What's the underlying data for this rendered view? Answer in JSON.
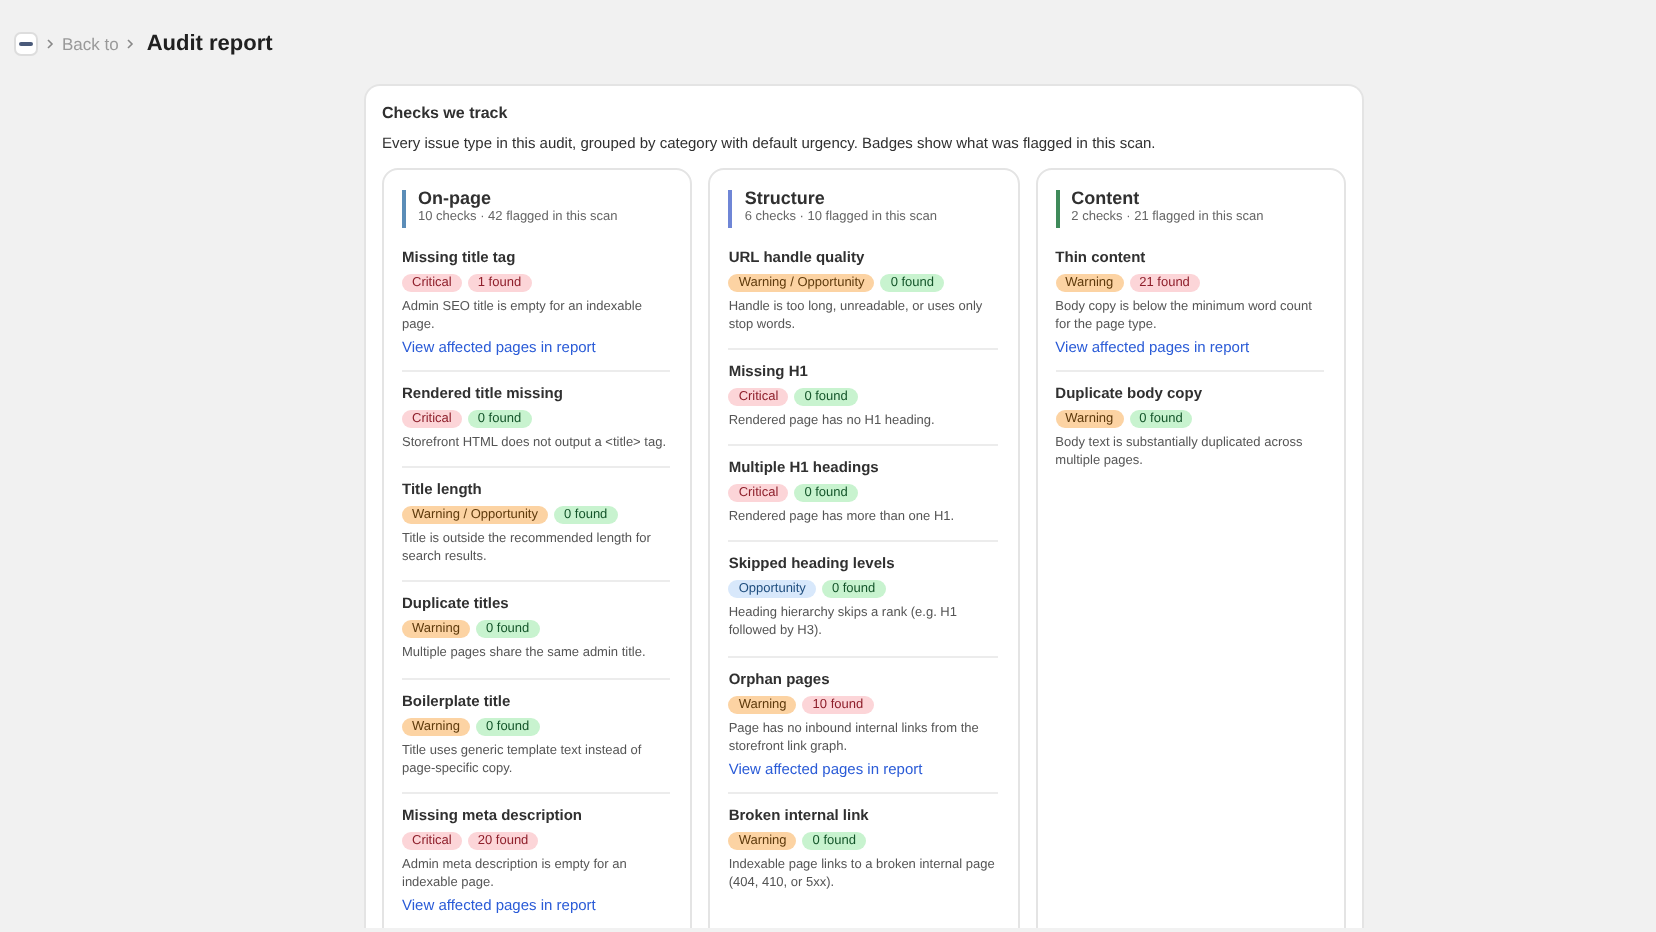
{
  "breadcrumb": {
    "back": "Back to",
    "title": "Audit report"
  },
  "panel": {
    "title": "Checks we track",
    "description": "Every issue type in this audit, grouped by category with default urgency. Badges show what was flagged in this scan."
  },
  "categories": [
    {
      "name": "On-page",
      "summary": "10 checks · 42 flagged in this scan",
      "color": "#5b8db8",
      "checks": [
        {
          "title": "Missing title tag",
          "kind": "critical",
          "severity_label": "Critical",
          "found": "1 found",
          "flagged": true,
          "description": "Admin SEO title is empty for an indexable page.",
          "link": "View affected pages in report"
        },
        {
          "title": "Rendered title missing",
          "kind": "critical",
          "severity_label": "Critical",
          "found": "0 found",
          "flagged": false,
          "description": "Storefront HTML does not output a <title> tag."
        },
        {
          "title": "Title length",
          "kind": "warning",
          "severity_label": "Warning / Opportunity",
          "found": "0 found",
          "flagged": false,
          "description": "Title is outside the recommended length for search results."
        },
        {
          "title": "Duplicate titles",
          "kind": "warning",
          "severity_label": "Warning",
          "found": "0 found",
          "flagged": false,
          "description": "Multiple pages share the same admin title."
        },
        {
          "title": "Boilerplate title",
          "kind": "warning",
          "severity_label": "Warning",
          "found": "0 found",
          "flagged": false,
          "description": "Title uses generic template text instead of page-specific copy."
        },
        {
          "title": "Missing meta description",
          "kind": "critical",
          "severity_label": "Critical",
          "found": "20 found",
          "flagged": true,
          "description": "Admin meta description is empty for an indexable page.",
          "link": "View affected pages in report"
        }
      ]
    },
    {
      "name": "Structure",
      "summary": "6 checks · 10 flagged in this scan",
      "color": "#6f86d6",
      "checks": [
        {
          "title": "URL handle quality",
          "kind": "warning",
          "severity_label": "Warning / Opportunity",
          "found": "0 found",
          "flagged": false,
          "description": "Handle is too long, unreadable, or uses only stop words."
        },
        {
          "title": "Missing H1",
          "kind": "critical",
          "severity_label": "Critical",
          "found": "0 found",
          "flagged": false,
          "description": "Rendered page has no H1 heading."
        },
        {
          "title": "Multiple H1 headings",
          "kind": "critical",
          "severity_label": "Critical",
          "found": "0 found",
          "flagged": false,
          "description": "Rendered page has more than one H1."
        },
        {
          "title": "Skipped heading levels",
          "kind": "opportunity",
          "severity_label": "Opportunity",
          "found": "0 found",
          "flagged": false,
          "description": "Heading hierarchy skips a rank (e.g. H1 followed by H3)."
        },
        {
          "title": "Orphan pages",
          "kind": "warning",
          "severity_label": "Warning",
          "found": "10 found",
          "flagged": true,
          "description": "Page has no inbound internal links from the storefront link graph.",
          "link": "View affected pages in report"
        },
        {
          "title": "Broken internal link",
          "kind": "warning",
          "severity_label": "Warning",
          "found": "0 found",
          "flagged": false,
          "description": "Indexable page links to a broken internal page (404, 410, or 5xx)."
        }
      ]
    },
    {
      "name": "Content",
      "summary": "2 checks · 21 flagged in this scan",
      "color": "#3f8a5a",
      "checks": [
        {
          "title": "Thin content",
          "kind": "warning",
          "severity_label": "Warning",
          "found": "21 found",
          "flagged": true,
          "description": "Body copy is below the minimum word count for the page type.",
          "link": "View affected pages in report"
        },
        {
          "title": "Duplicate body copy",
          "kind": "warning",
          "severity_label": "Warning",
          "found": "0 found",
          "flagged": false,
          "description": "Body text is substantially duplicated across multiple pages."
        }
      ]
    }
  ]
}
